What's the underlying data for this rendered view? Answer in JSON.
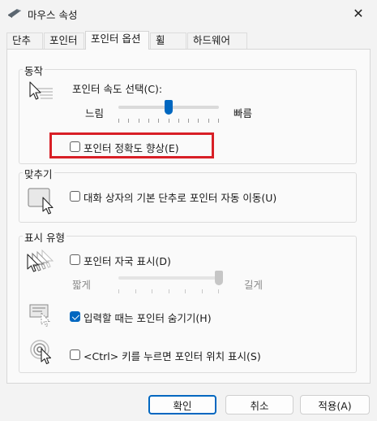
{
  "window": {
    "title": "마우스 속성",
    "close_glyph": "✕"
  },
  "tabs": [
    {
      "label": "단추"
    },
    {
      "label": "포인터"
    },
    {
      "label": "포인터 옵션"
    },
    {
      "label": "휠"
    },
    {
      "label": "하드웨어"
    }
  ],
  "motion": {
    "group_label": "동작",
    "speed_label": "포인터 속도 선택(C):",
    "slow_label": "느림",
    "fast_label": "빠름",
    "speed_value_fraction": 0.5,
    "precision_label": "포인터 정확도 향상(E)",
    "precision_checked": false
  },
  "snap_to": {
    "group_label": "맞추기",
    "snap_label": "대화 상자의 기본 단추로 포인터 자동 이동(U)",
    "snap_checked": false
  },
  "visibility": {
    "group_label": "표시 유형",
    "trails_label": "포인터 자국 표시(D)",
    "trails_checked": false,
    "trails_short_label": "짧게",
    "trails_long_label": "길게",
    "trails_value_fraction": 1.0,
    "hide_label": "입력할 때는 포인터 숨기기(H)",
    "hide_checked": true,
    "ctrl_label": "<Ctrl> 키를 누르면 포인터 위치 표시(S)",
    "ctrl_checked": false
  },
  "buttons": {
    "ok": "확인",
    "cancel": "취소",
    "apply": "적용(A)"
  },
  "colors": {
    "accent": "#0067c0",
    "highlight": "#d81f26"
  }
}
